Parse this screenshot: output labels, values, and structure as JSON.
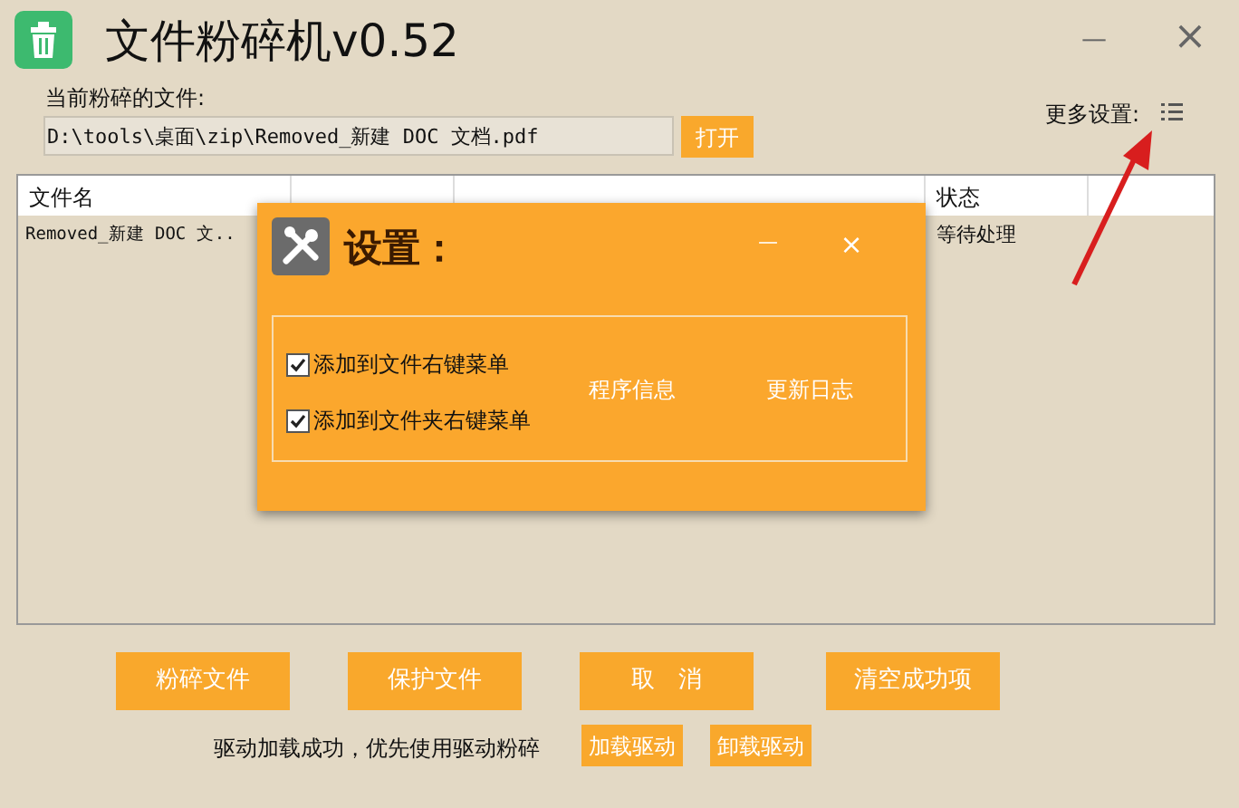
{
  "window": {
    "title": "文件粉碎机v0.52",
    "minimize": "—",
    "close": "×"
  },
  "current_file": {
    "label": "当前粉碎的文件:",
    "value": "D:\\tools\\桌面\\zip\\Removed_新建 DOC 文档.pdf",
    "open_button": "打开"
  },
  "more_settings": {
    "label": "更多设置:"
  },
  "table": {
    "columns": [
      "文件名",
      "状态"
    ],
    "rows": [
      {
        "cells": [
          "Removed_新建 DOC 文..",
          "等待处理"
        ]
      }
    ]
  },
  "settings_dialog": {
    "title": "设置：",
    "minimize": "—",
    "close": "×",
    "options": [
      {
        "label": "添加到文件右键菜单",
        "checked": true
      },
      {
        "label": "添加到文件夹右键菜单",
        "checked": true
      }
    ],
    "buttons": [
      "程序信息",
      "更新日志"
    ]
  },
  "actions": [
    "粉碎文件",
    "保护文件",
    "取　消",
    "清空成功项"
  ],
  "driver": {
    "status": "驱动加载成功，优先使用驱动粉碎",
    "buttons": [
      "加载驱动",
      "卸载驱动"
    ]
  }
}
